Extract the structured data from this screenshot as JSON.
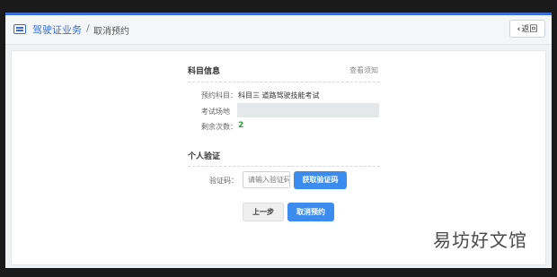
{
  "header": {
    "title": "驾驶证业务",
    "separator": "/",
    "subtitle": "取消预约",
    "back_label": "返回",
    "accent_color": "#3b6fd6"
  },
  "subject_section": {
    "title": "科目信息",
    "note_link": "查看须知",
    "fields": [
      {
        "label": "预约科目：",
        "value": "科目三 道路驾驶技能考试"
      },
      {
        "label": "考试场地",
        "value": ""
      },
      {
        "label": "剩余次数：",
        "value": "2"
      }
    ]
  },
  "verify_section": {
    "title": "个人验证",
    "code_label": "验证码：",
    "code_placeholder": "请输入验证码",
    "get_code_button": "获取验证码"
  },
  "actions": {
    "prev_label": "上一步",
    "cancel_label": "取消预约"
  },
  "watermark": "易坊好文馆",
  "icons": [
    "list-icon",
    "chevron-left-icon"
  ]
}
